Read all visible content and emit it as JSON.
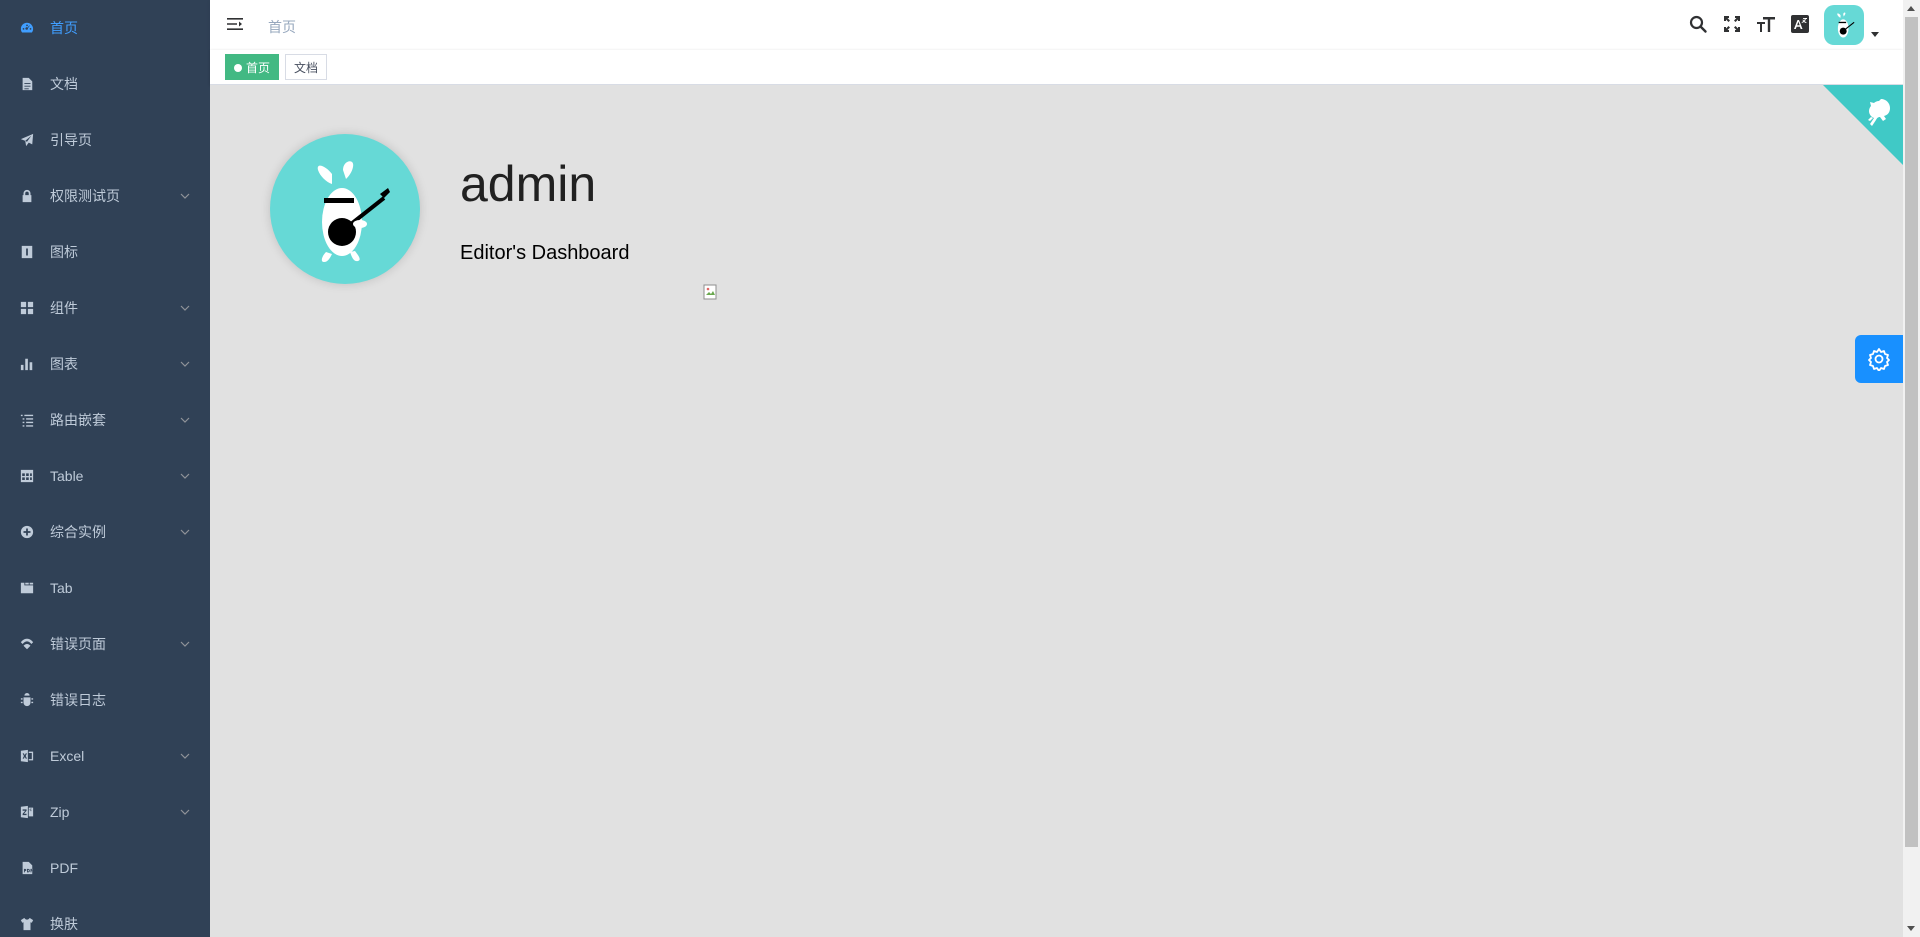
{
  "sidebar": {
    "items": [
      {
        "label": "首页",
        "icon": "dashboard-icon",
        "active": true,
        "has_children": false
      },
      {
        "label": "文档",
        "icon": "documentation-icon",
        "active": false,
        "has_children": false
      },
      {
        "label": "引导页",
        "icon": "guide-icon",
        "active": false,
        "has_children": false
      },
      {
        "label": "权限测试页",
        "icon": "lock-icon",
        "active": false,
        "has_children": true
      },
      {
        "label": "图标",
        "icon": "icon-icon",
        "active": false,
        "has_children": false
      },
      {
        "label": "组件",
        "icon": "component-icon",
        "active": false,
        "has_children": true
      },
      {
        "label": "图表",
        "icon": "chart-icon",
        "active": false,
        "has_children": true
      },
      {
        "label": "路由嵌套",
        "icon": "nested-icon",
        "active": false,
        "has_children": true
      },
      {
        "label": "Table",
        "icon": "table-icon",
        "active": false,
        "has_children": true
      },
      {
        "label": "综合实例",
        "icon": "example-icon",
        "active": false,
        "has_children": true
      },
      {
        "label": "Tab",
        "icon": "tab-icon",
        "active": false,
        "has_children": false
      },
      {
        "label": "错误页面",
        "icon": "404-icon",
        "active": false,
        "has_children": true
      },
      {
        "label": "错误日志",
        "icon": "bug-icon",
        "active": false,
        "has_children": false
      },
      {
        "label": "Excel",
        "icon": "excel-icon",
        "active": false,
        "has_children": true
      },
      {
        "label": "Zip",
        "icon": "zip-icon",
        "active": false,
        "has_children": true
      },
      {
        "label": "PDF",
        "icon": "pdf-icon",
        "active": false,
        "has_children": false
      },
      {
        "label": "换肤",
        "icon": "theme-icon",
        "active": false,
        "has_children": false
      }
    ]
  },
  "navbar": {
    "breadcrumb": "首页",
    "tools": [
      "search-icon",
      "fullscreen-icon",
      "size-icon",
      "language-icon"
    ]
  },
  "tags": [
    {
      "label": "首页",
      "active": true
    },
    {
      "label": "文档",
      "active": false
    }
  ],
  "main": {
    "username": "admin",
    "role_text": "Editor's Dashboard"
  },
  "colors": {
    "sidebar_bg": "#304156",
    "sidebar_text": "#bfcbd9",
    "sidebar_active": "#409eff",
    "tag_active": "#42b983",
    "avatar_bg": "#66d9d6",
    "settings_btn": "#1890ff",
    "content_bg": "#e1e1e1"
  }
}
